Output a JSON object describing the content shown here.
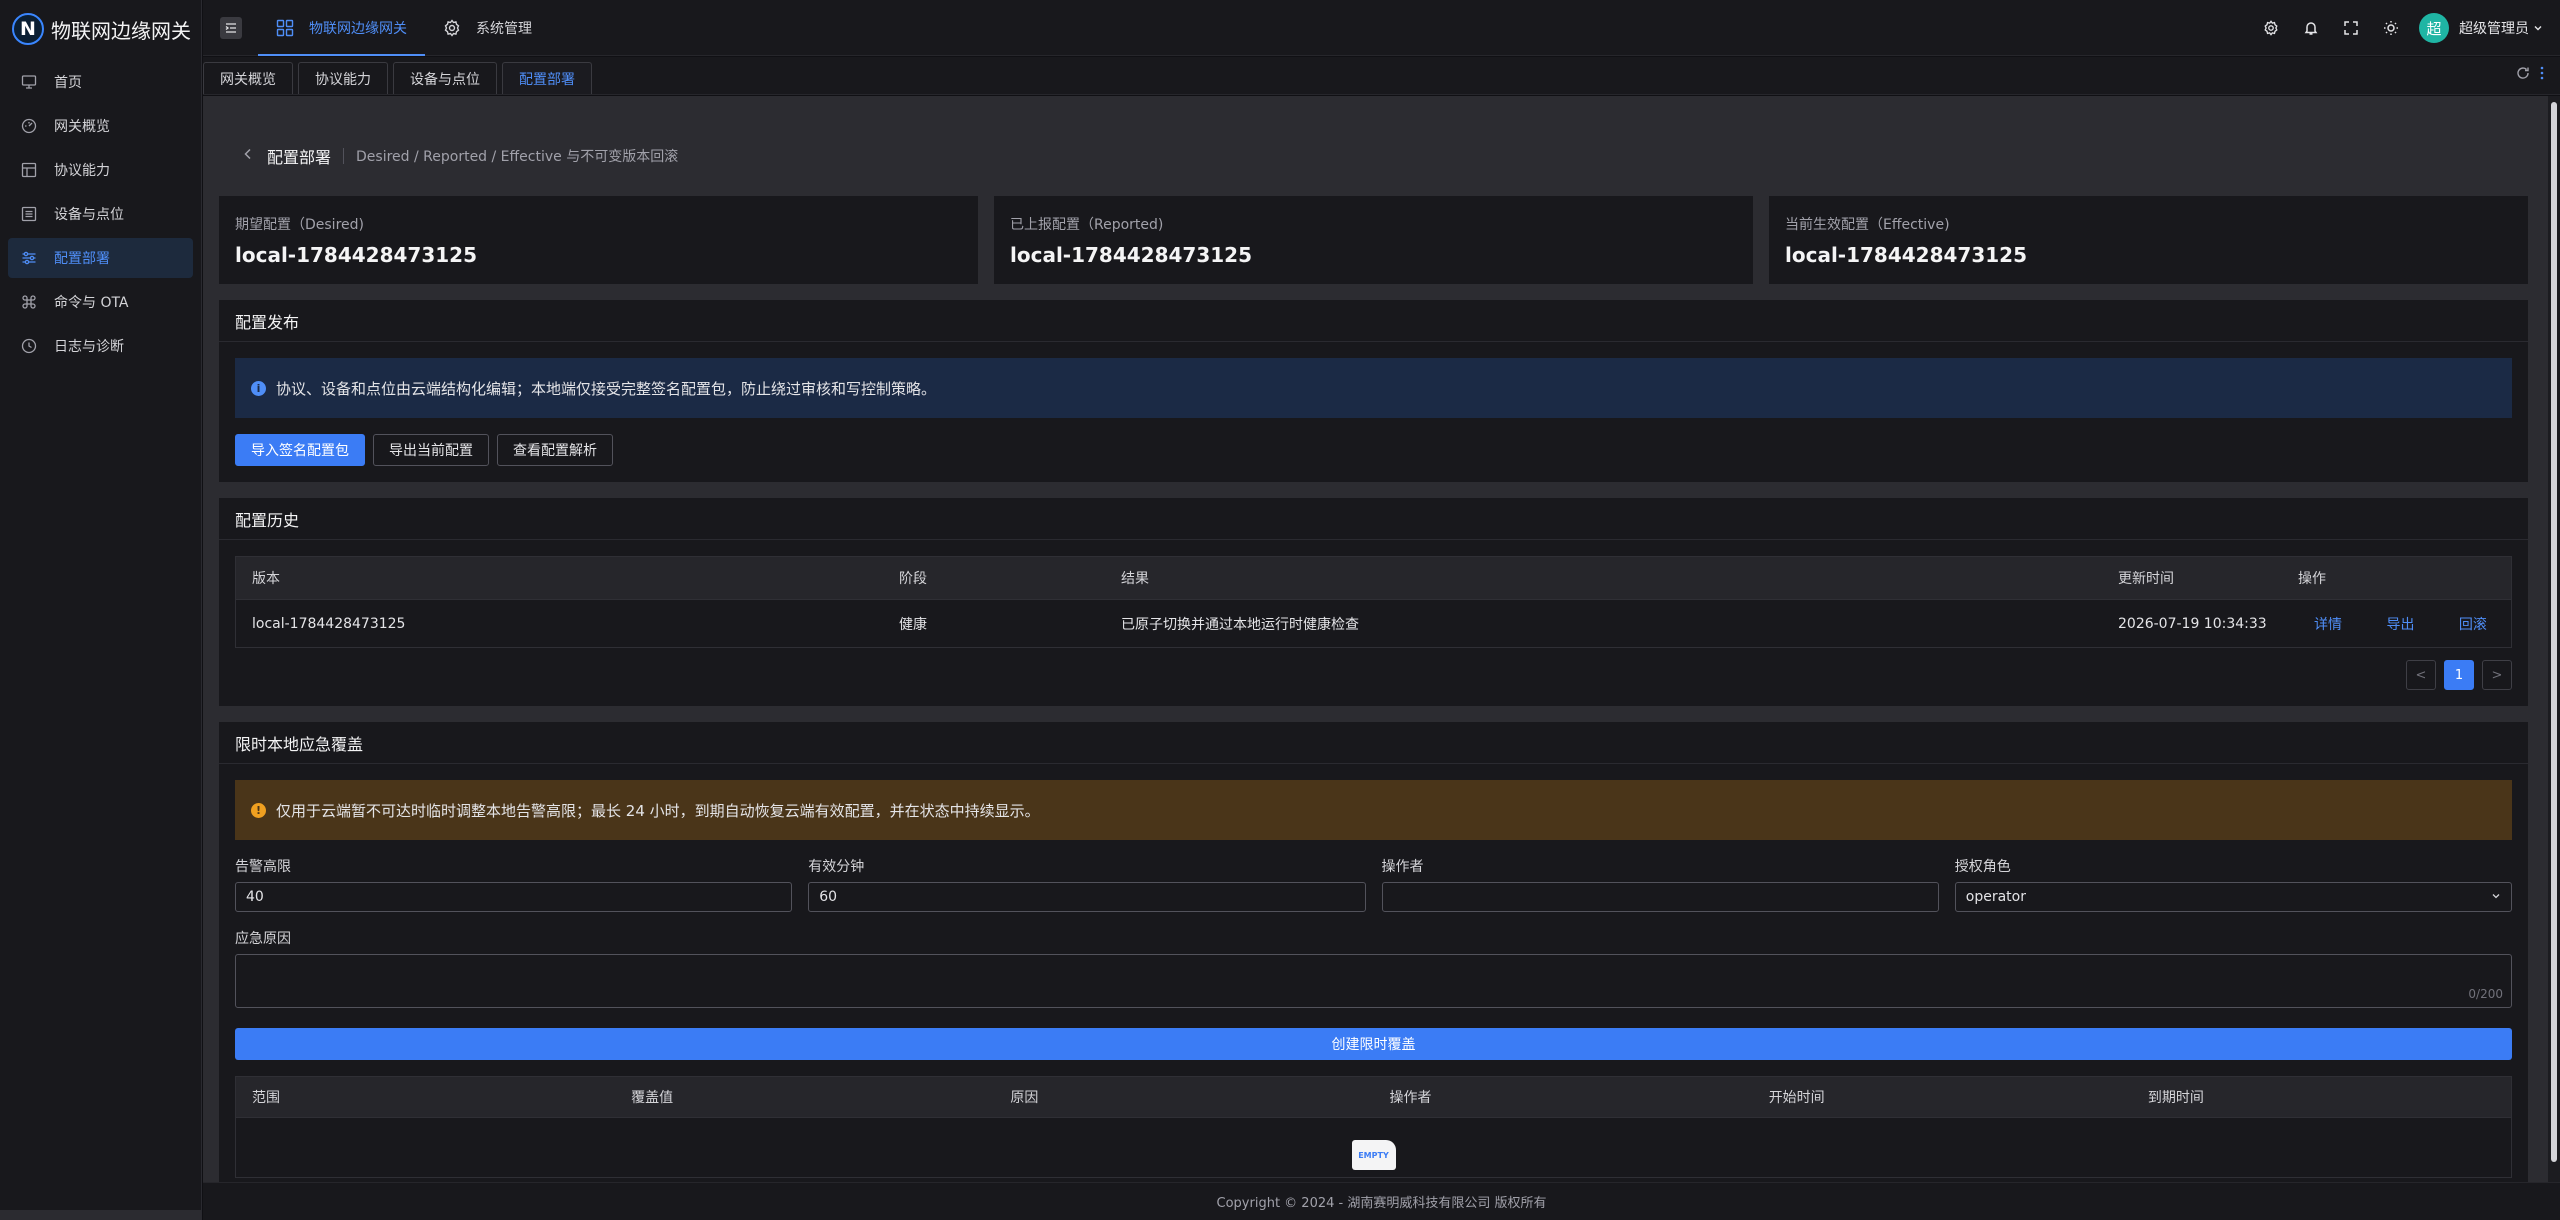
{
  "app": {
    "logo_letter": "N",
    "title": "物联网边缘网关"
  },
  "sidebar": {
    "items": [
      {
        "label": "首页",
        "icon": "monitor-icon"
      },
      {
        "label": "网关概览",
        "icon": "dashboard-icon"
      },
      {
        "label": "协议能力",
        "icon": "layout-icon"
      },
      {
        "label": "设备与点位",
        "icon": "list-icon"
      },
      {
        "label": "配置部署",
        "icon": "sliders-icon",
        "active": true
      },
      {
        "label": "命令与 OTA",
        "icon": "command-icon"
      },
      {
        "label": "日志与诊断",
        "icon": "clock-icon"
      }
    ]
  },
  "header": {
    "nav": [
      {
        "label": "物联网边缘网关",
        "active": true
      },
      {
        "label": "系统管理",
        "active": false
      }
    ],
    "avatar_text": "超",
    "username": "超级管理员"
  },
  "tabs": [
    "网关概览",
    "协议能力",
    "设备与点位",
    "配置部署"
  ],
  "page": {
    "title": "配置部署",
    "subtitle": "Desired / Reported / Effective 与不可变版本回滚"
  },
  "cards": [
    {
      "label": "期望配置（Desired)",
      "value": "local-1784428473125"
    },
    {
      "label": "已上报配置（Reported)",
      "value": "local-1784428473125"
    },
    {
      "label": "当前生效配置（Effective)",
      "value": "local-1784428473125"
    }
  ],
  "publish": {
    "title": "配置发布",
    "alert": "协议、设备和点位由云端结构化编辑；本地端仅接受完整签名配置包，防止绕过审核和写控制策略。",
    "buttons": [
      "导入签名配置包",
      "导出当前配置",
      "查看配置解析"
    ]
  },
  "history": {
    "title": "配置历史",
    "columns": [
      "版本",
      "阶段",
      "结果",
      "更新时间",
      "操作"
    ],
    "rows": [
      {
        "version": "local-1784428473125",
        "stage": "健康",
        "result": "已原子切换并通过本地运行时健康检查",
        "time": "2026-07-19 10:34:33",
        "ops": [
          "详情",
          "导出",
          "回滚"
        ]
      }
    ],
    "pager": {
      "prev": "<",
      "current": "1",
      "next": ">"
    }
  },
  "override": {
    "title": "限时本地应急覆盖",
    "alert": "仅用于云端暂不可达时临时调整本地告警高限；最长 24 小时，到期自动恢复云端有效配置，并在状态中持续显示。",
    "fields": {
      "alarm_high": {
        "label": "告警高限",
        "value": "40"
      },
      "valid_minutes": {
        "label": "有效分钟",
        "value": "60"
      },
      "operator": {
        "label": "操作者",
        "value": ""
      },
      "role": {
        "label": "授权角色",
        "value": "operator"
      }
    },
    "reason": {
      "label": "应急原因",
      "count": "0/200"
    },
    "create_button": "创建限时覆盖",
    "columns": [
      "范围",
      "覆盖值",
      "原因",
      "操作者",
      "开始时间",
      "到期时间"
    ],
    "empty_icon_text": "EMPTY"
  },
  "footer": {
    "copyright": "Copyright © 2024 - 湖南赛明威科技有限公司 版权所有"
  },
  "colors": {
    "accent": "#3b7cf5",
    "info_bg": "#1b2a45",
    "warn_bg": "#4a3519"
  }
}
